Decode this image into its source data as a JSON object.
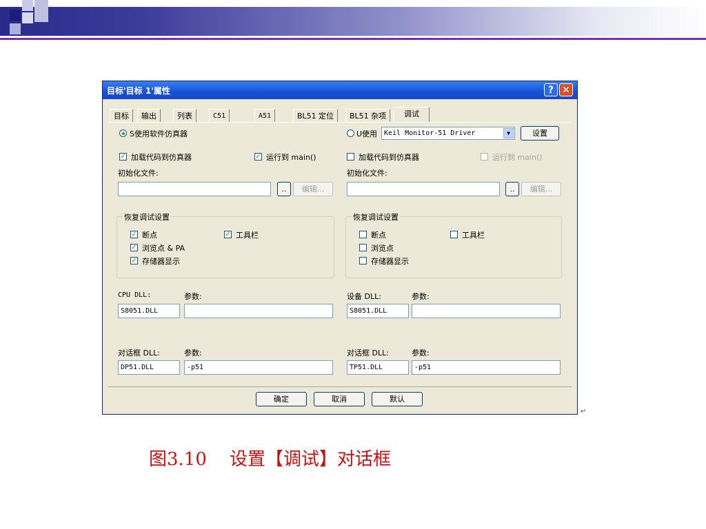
{
  "slide": {
    "caption": "图3.10    设置【调试】对话框",
    "return_mark": "↵"
  },
  "dialog": {
    "title": "目标'目标 1'属性",
    "help_label": "?",
    "close_label": "✕",
    "tabs": [
      "目标",
      "输出",
      "列表",
      "C51",
      "A51",
      "BL51 定位",
      "BL51 杂项",
      "调试"
    ],
    "active_tab": "调试",
    "left": {
      "mode_label": "S使用软件仿真器",
      "load_code_label": "加载代码到仿真器",
      "run_to_main_label": "运行到 main()",
      "init_file_label": "初始化文件:",
      "init_file_value": "",
      "browse_label": "..",
      "edit_label": "编辑...",
      "restore_group_title": "恢复调试设置",
      "restore": {
        "breakpoints": "断点",
        "toolbar": "工具栏",
        "watch": "浏览点 & PA",
        "memory": "存储器显示"
      },
      "dll_label": "CPU DLL:",
      "dll_param_label": "参数:",
      "dll_value": "S8051.DLL",
      "dll_param_value": "",
      "dialog_dll_label": "对话框 DLL:",
      "dialog_param_label": "参数:",
      "dialog_dll_value": "DP51.DLL",
      "dialog_param_value": "-p51"
    },
    "right": {
      "mode_label": "U使用",
      "driver_value": "Keil Monitor-51 Driver",
      "settings_label": "设置",
      "load_code_label": "加载代码到仿真器",
      "run_to_main_label": "运行到 main()",
      "init_file_label": "初始化文件:",
      "init_file_value": "",
      "browse_label": "..",
      "edit_label": "编辑...",
      "restore_group_title": "恢复调试设置",
      "restore": {
        "breakpoints": "断点",
        "toolbar": "工具栏",
        "watch": "浏览点",
        "memory": "存储器显示"
      },
      "dll_label": "设备 DLL:",
      "dll_param_label": "参数:",
      "dll_value": "S8051.DLL",
      "dll_param_value": "",
      "dialog_dll_label": "对话框 DLL:",
      "dialog_param_label": "参数:",
      "dialog_dll_value": "TP51.DLL",
      "dialog_param_value": "-p51"
    },
    "buttons": {
      "ok": "确定",
      "cancel": "取消",
      "default": "默认"
    },
    "check_glyph": "✓"
  }
}
